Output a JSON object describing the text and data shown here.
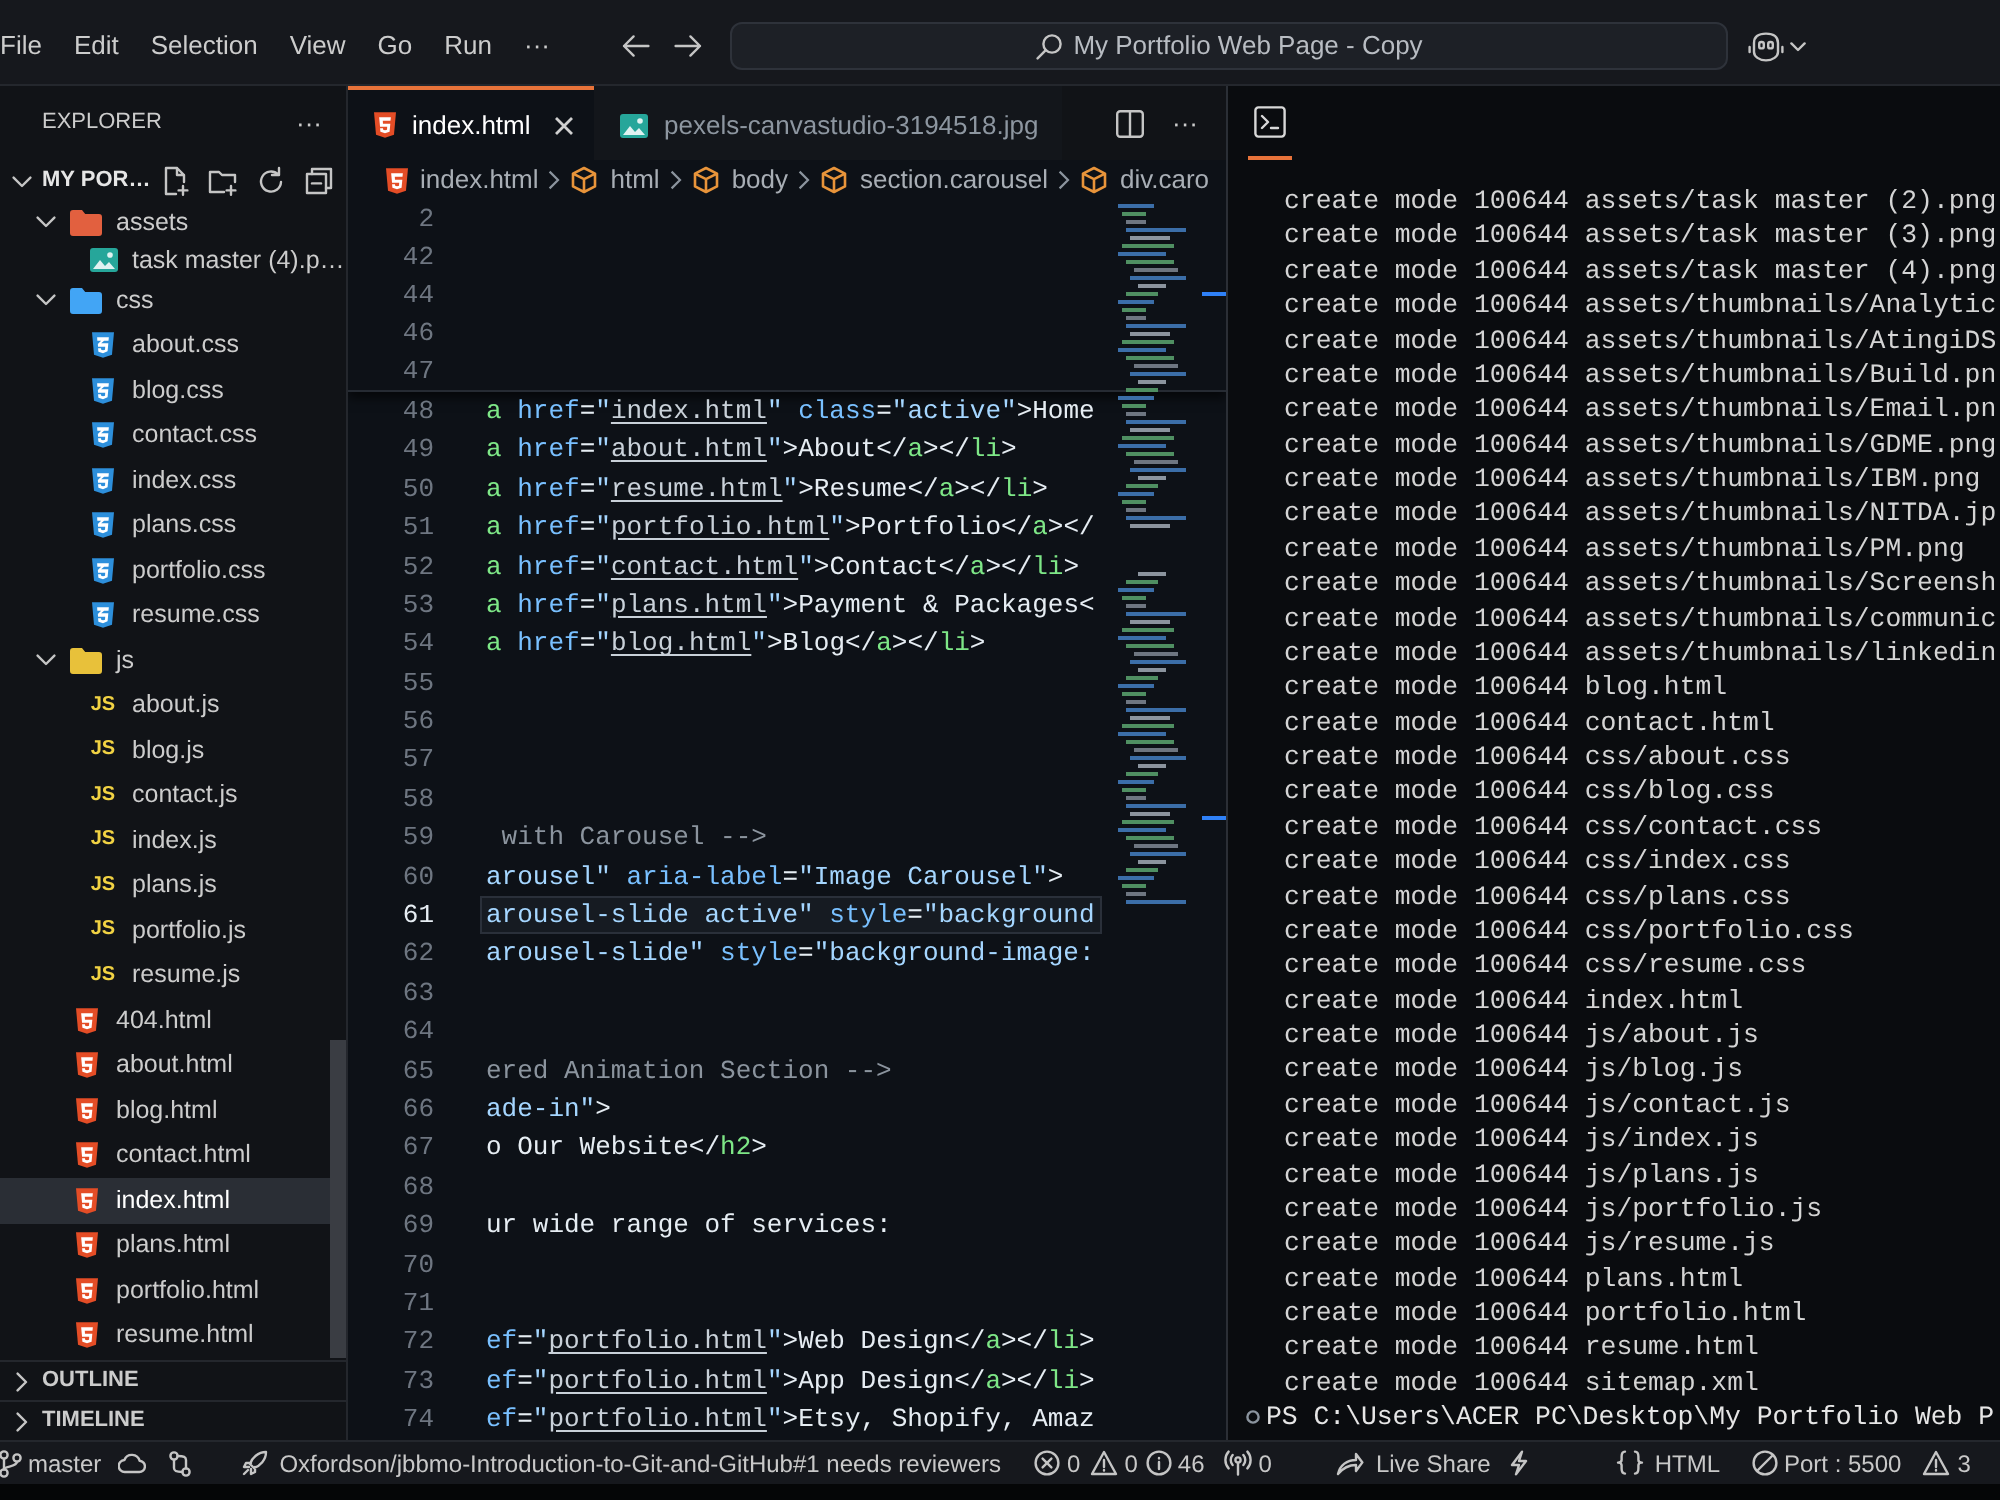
{
  "title_bar": {
    "menu": [
      "File",
      "Edit",
      "Selection",
      "View",
      "Go",
      "Run",
      "···"
    ],
    "command_center": "My Portfolio Web Page - Copy"
  },
  "explorer": {
    "title": "EXPLORER",
    "more": "···",
    "folder": {
      "name": "MY POR…",
      "expanded": true
    },
    "tree": [
      {
        "name": "assets",
        "kind": "folder",
        "color": "#e2603f",
        "expanded": true,
        "selected": false,
        "children": [
          {
            "name": "task master (4).p…",
            "kind": "image",
            "selected": false
          }
        ]
      },
      {
        "name": "css",
        "kind": "folder",
        "color": "#42a5f5",
        "expanded": true,
        "selected": false,
        "children": [
          {
            "name": "about.css",
            "kind": "css",
            "selected": false
          },
          {
            "name": "blog.css",
            "kind": "css",
            "selected": false
          },
          {
            "name": "contact.css",
            "kind": "css",
            "selected": false
          },
          {
            "name": "index.css",
            "kind": "css",
            "selected": false
          },
          {
            "name": "plans.css",
            "kind": "css",
            "selected": false
          },
          {
            "name": "portfolio.css",
            "kind": "css",
            "selected": false
          },
          {
            "name": "resume.css",
            "kind": "css",
            "selected": false
          }
        ]
      },
      {
        "name": "js",
        "kind": "folder",
        "color": "#e8c13a",
        "expanded": true,
        "selected": false,
        "children": [
          {
            "name": "about.js",
            "kind": "js",
            "icon": "JS",
            "selected": false
          },
          {
            "name": "blog.js",
            "kind": "js",
            "icon": "JS",
            "selected": false
          },
          {
            "name": "contact.js",
            "kind": "js",
            "icon": "JS",
            "selected": false
          },
          {
            "name": "index.js",
            "kind": "js",
            "icon": "JS",
            "selected": false
          },
          {
            "name": "plans.js",
            "kind": "js",
            "icon": "JS",
            "selected": false
          },
          {
            "name": "portfolio.js",
            "kind": "js",
            "icon": "JS",
            "selected": false
          },
          {
            "name": "resume.js",
            "kind": "js",
            "icon": "JS",
            "selected": false
          }
        ]
      },
      {
        "name": "404.html",
        "kind": "html",
        "selected": false
      },
      {
        "name": "about.html",
        "kind": "html",
        "selected": false
      },
      {
        "name": "blog.html",
        "kind": "html",
        "selected": false
      },
      {
        "name": "contact.html",
        "kind": "html",
        "selected": false
      },
      {
        "name": "index.html",
        "kind": "html",
        "selected": true
      },
      {
        "name": "plans.html",
        "kind": "html",
        "selected": false
      },
      {
        "name": "portfolio.html",
        "kind": "html",
        "selected": false
      },
      {
        "name": "resume.html",
        "kind": "html",
        "selected": false
      }
    ],
    "sections": [
      {
        "label": "OUTLINE",
        "expanded": false
      },
      {
        "label": "TIMELINE",
        "expanded": false
      }
    ]
  },
  "editor": {
    "tabs": [
      {
        "label": "index.html",
        "kind": "html",
        "selected": true
      },
      {
        "label": "pexels-canvastudio-3194518.jpg",
        "kind": "image",
        "selected": false
      }
    ],
    "more": "···",
    "breadcrumbs": [
      {
        "label": "index.html",
        "kind": "file"
      },
      {
        "label": "html",
        "kind": "element"
      },
      {
        "label": "body",
        "kind": "element"
      },
      {
        "label": "section.carousel",
        "kind": "element"
      },
      {
        "label": "div.caro",
        "kind": "element"
      }
    ],
    "sticky_lines": [
      "2",
      "42",
      "44",
      "46",
      "47"
    ],
    "lines": [
      {
        "number": "48",
        "current": false,
        "tokens": [
          {
            "kind": "tag",
            "text": "a"
          },
          {
            "kind": "attr",
            "text": " href"
          },
          {
            "kind": "text",
            "text": "="
          },
          {
            "kind": "string",
            "text": "\""
          },
          {
            "kind": "link",
            "text": "index.html"
          },
          {
            "kind": "string",
            "text": "\""
          },
          {
            "kind": "attr",
            "text": " class"
          },
          {
            "kind": "text",
            "text": "="
          },
          {
            "kind": "string",
            "text": "\"active\""
          },
          {
            "kind": "text",
            "text": ">Home"
          }
        ]
      },
      {
        "number": "49",
        "current": false,
        "tokens": [
          {
            "kind": "tag",
            "text": "a"
          },
          {
            "kind": "attr",
            "text": " href"
          },
          {
            "kind": "text",
            "text": "="
          },
          {
            "kind": "string",
            "text": "\""
          },
          {
            "kind": "link",
            "text": "about.html"
          },
          {
            "kind": "string",
            "text": "\""
          },
          {
            "kind": "text",
            "text": ">About</"
          },
          {
            "kind": "tag",
            "text": "a"
          },
          {
            "kind": "text",
            "text": "></"
          },
          {
            "kind": "tag",
            "text": "li"
          },
          {
            "kind": "text",
            "text": ">"
          }
        ]
      },
      {
        "number": "50",
        "current": false,
        "tokens": [
          {
            "kind": "tag",
            "text": "a"
          },
          {
            "kind": "attr",
            "text": " href"
          },
          {
            "kind": "text",
            "text": "="
          },
          {
            "kind": "string",
            "text": "\""
          },
          {
            "kind": "link",
            "text": "resume.html"
          },
          {
            "kind": "string",
            "text": "\""
          },
          {
            "kind": "text",
            "text": ">Resume</"
          },
          {
            "kind": "tag",
            "text": "a"
          },
          {
            "kind": "text",
            "text": "></"
          },
          {
            "kind": "tag",
            "text": "li"
          },
          {
            "kind": "text",
            "text": ">"
          }
        ]
      },
      {
        "number": "51",
        "current": false,
        "tokens": [
          {
            "kind": "tag",
            "text": "a"
          },
          {
            "kind": "attr",
            "text": " href"
          },
          {
            "kind": "text",
            "text": "="
          },
          {
            "kind": "string",
            "text": "\""
          },
          {
            "kind": "link",
            "text": "portfolio.html"
          },
          {
            "kind": "string",
            "text": "\""
          },
          {
            "kind": "text",
            "text": ">Portfolio</"
          },
          {
            "kind": "tag",
            "text": "a"
          },
          {
            "kind": "text",
            "text": "></"
          }
        ]
      },
      {
        "number": "52",
        "current": false,
        "tokens": [
          {
            "kind": "tag",
            "text": "a"
          },
          {
            "kind": "attr",
            "text": " href"
          },
          {
            "kind": "text",
            "text": "="
          },
          {
            "kind": "string",
            "text": "\""
          },
          {
            "kind": "link",
            "text": "contact.html"
          },
          {
            "kind": "string",
            "text": "\""
          },
          {
            "kind": "text",
            "text": ">Contact</"
          },
          {
            "kind": "tag",
            "text": "a"
          },
          {
            "kind": "text",
            "text": "></"
          },
          {
            "kind": "tag",
            "text": "li"
          },
          {
            "kind": "text",
            "text": ">"
          }
        ]
      },
      {
        "number": "53",
        "current": false,
        "tokens": [
          {
            "kind": "tag",
            "text": "a"
          },
          {
            "kind": "attr",
            "text": " href"
          },
          {
            "kind": "text",
            "text": "="
          },
          {
            "kind": "string",
            "text": "\""
          },
          {
            "kind": "link",
            "text": "plans.html"
          },
          {
            "kind": "string",
            "text": "\""
          },
          {
            "kind": "text",
            "text": ">Payment & Packages<"
          }
        ]
      },
      {
        "number": "54",
        "current": false,
        "tokens": [
          {
            "kind": "tag",
            "text": "a"
          },
          {
            "kind": "attr",
            "text": " href"
          },
          {
            "kind": "text",
            "text": "="
          },
          {
            "kind": "string",
            "text": "\""
          },
          {
            "kind": "link",
            "text": "blog.html"
          },
          {
            "kind": "string",
            "text": "\""
          },
          {
            "kind": "text",
            "text": ">Blog</"
          },
          {
            "kind": "tag",
            "text": "a"
          },
          {
            "kind": "text",
            "text": "></"
          },
          {
            "kind": "tag",
            "text": "li"
          },
          {
            "kind": "text",
            "text": ">"
          }
        ]
      },
      {
        "number": "55",
        "current": false
      },
      {
        "number": "56",
        "current": false
      },
      {
        "number": "57",
        "current": false
      },
      {
        "number": "58",
        "current": false
      },
      {
        "number": "59",
        "current": false,
        "tokens": [
          {
            "kind": "comment",
            "text": " with Carousel -->"
          }
        ]
      },
      {
        "number": "60",
        "current": false,
        "tokens": [
          {
            "kind": "string",
            "text": "arousel\""
          },
          {
            "kind": "attr",
            "text": " aria-label"
          },
          {
            "kind": "text",
            "text": "="
          },
          {
            "kind": "string",
            "text": "\"Image Carousel\""
          },
          {
            "kind": "text",
            "text": ">"
          }
        ]
      },
      {
        "number": "61",
        "current": true,
        "tokens": [
          {
            "kind": "string",
            "text": "arousel-slide active\""
          },
          {
            "kind": "attr",
            "text": " style"
          },
          {
            "kind": "text",
            "text": "="
          },
          {
            "kind": "string",
            "text": "\"background"
          }
        ]
      },
      {
        "number": "62",
        "current": false,
        "tokens": [
          {
            "kind": "string",
            "text": "arousel-slide\""
          },
          {
            "kind": "attr",
            "text": " style"
          },
          {
            "kind": "text",
            "text": "="
          },
          {
            "kind": "string",
            "text": "\"background-image:"
          }
        ]
      },
      {
        "number": "63",
        "current": false
      },
      {
        "number": "64",
        "current": false
      },
      {
        "number": "65",
        "current": false,
        "tokens": [
          {
            "kind": "comment",
            "text": "ered Animation Section -->"
          }
        ]
      },
      {
        "number": "66",
        "current": false,
        "tokens": [
          {
            "kind": "string",
            "text": "ade-in\""
          },
          {
            "kind": "text",
            "text": ">"
          }
        ]
      },
      {
        "number": "67",
        "current": false,
        "tokens": [
          {
            "kind": "text",
            "text": "o Our Website</"
          },
          {
            "kind": "tag",
            "text": "h2"
          },
          {
            "kind": "text",
            "text": ">"
          }
        ]
      },
      {
        "number": "68",
        "current": false
      },
      {
        "number": "69",
        "current": false,
        "tokens": [
          {
            "kind": "text",
            "text": "ur wide range of services:"
          }
        ]
      },
      {
        "number": "70",
        "current": false
      },
      {
        "number": "71",
        "current": false
      },
      {
        "number": "72",
        "current": false,
        "tokens": [
          {
            "kind": "attr",
            "text": "ef"
          },
          {
            "kind": "text",
            "text": "="
          },
          {
            "kind": "string",
            "text": "\""
          },
          {
            "kind": "link",
            "text": "portfolio.html"
          },
          {
            "kind": "string",
            "text": "\""
          },
          {
            "kind": "text",
            "text": ">Web Design</"
          },
          {
            "kind": "tag",
            "text": "a"
          },
          {
            "kind": "text",
            "text": "></"
          },
          {
            "kind": "tag",
            "text": "li"
          },
          {
            "kind": "text",
            "text": ">"
          }
        ]
      },
      {
        "number": "73",
        "current": false,
        "tokens": [
          {
            "kind": "attr",
            "text": "ef"
          },
          {
            "kind": "text",
            "text": "="
          },
          {
            "kind": "string",
            "text": "\""
          },
          {
            "kind": "link",
            "text": "portfolio.html"
          },
          {
            "kind": "string",
            "text": "\""
          },
          {
            "kind": "text",
            "text": ">App Design</"
          },
          {
            "kind": "tag",
            "text": "a"
          },
          {
            "kind": "text",
            "text": "></"
          },
          {
            "kind": "tag",
            "text": "li"
          },
          {
            "kind": "text",
            "text": ">"
          }
        ]
      },
      {
        "number": "74",
        "current": false,
        "tokens": [
          {
            "kind": "attr",
            "text": "ef"
          },
          {
            "kind": "text",
            "text": "="
          },
          {
            "kind": "string",
            "text": "\""
          },
          {
            "kind": "link",
            "text": "portfolio.html"
          },
          {
            "kind": "string",
            "text": "\""
          },
          {
            "kind": "text",
            "text": ">Etsy, Shopify, Amaz"
          }
        ]
      }
    ]
  },
  "terminal": {
    "tabs": [
      {
        "kind": "terminal",
        "selected": true
      }
    ],
    "output": [
      "create mode 100644 assets/task master (2).png",
      "create mode 100644 assets/task master (3).png",
      "create mode 100644 assets/task master (4).png",
      "create mode 100644 assets/thumbnails/Analytic",
      "create mode 100644 assets/thumbnails/AtingiDS",
      "create mode 100644 assets/thumbnails/Build.pn",
      "create mode 100644 assets/thumbnails/Email.pn",
      "create mode 100644 assets/thumbnails/GDME.png",
      "create mode 100644 assets/thumbnails/IBM.png",
      "create mode 100644 assets/thumbnails/NITDA.jp",
      "create mode 100644 assets/thumbnails/PM.png",
      "create mode 100644 assets/thumbnails/Screensh",
      "create mode 100644 assets/thumbnails/communic",
      "create mode 100644 assets/thumbnails/linkedin",
      "create mode 100644 blog.html",
      "create mode 100644 contact.html",
      "create mode 100644 css/about.css",
      "create mode 100644 css/blog.css",
      "create mode 100644 css/contact.css",
      "create mode 100644 css/index.css",
      "create mode 100644 css/plans.css",
      "create mode 100644 css/portfolio.css",
      "create mode 100644 css/resume.css",
      "create mode 100644 index.html",
      "create mode 100644 js/about.js",
      "create mode 100644 js/blog.js",
      "create mode 100644 js/contact.js",
      "create mode 100644 js/index.js",
      "create mode 100644 js/plans.js",
      "create mode 100644 js/portfolio.js",
      "create mode 100644 js/resume.js",
      "create mode 100644 plans.html",
      "create mode 100644 portfolio.html",
      "create mode 100644 resume.html",
      "create mode 100644 sitemap.xml"
    ],
    "prompt": "PS C:\\Users\\ACER PC\\Desktop\\My Portfolio Web P"
  },
  "status_bar": [
    {
      "kind": "branch",
      "text": "master"
    },
    {
      "kind": "sync"
    },
    {
      "kind": "graph"
    },
    {
      "kind": "pullrequest",
      "text": "Oxfordson/jbbmo-Introduction-to-Git-and-GitHub#1 needs reviewers"
    },
    {
      "kind": "problems",
      "errors": "0",
      "warnings": "0",
      "infos": "46"
    },
    {
      "kind": "ports",
      "text": "0"
    },
    {
      "kind": "liveshare",
      "text": "Live Share"
    },
    {
      "kind": "bolt"
    },
    {
      "kind": "language",
      "text": "HTML"
    },
    {
      "kind": "server",
      "text": "Port : 5500"
    },
    {
      "kind": "alerts",
      "text": "3"
    }
  ]
}
